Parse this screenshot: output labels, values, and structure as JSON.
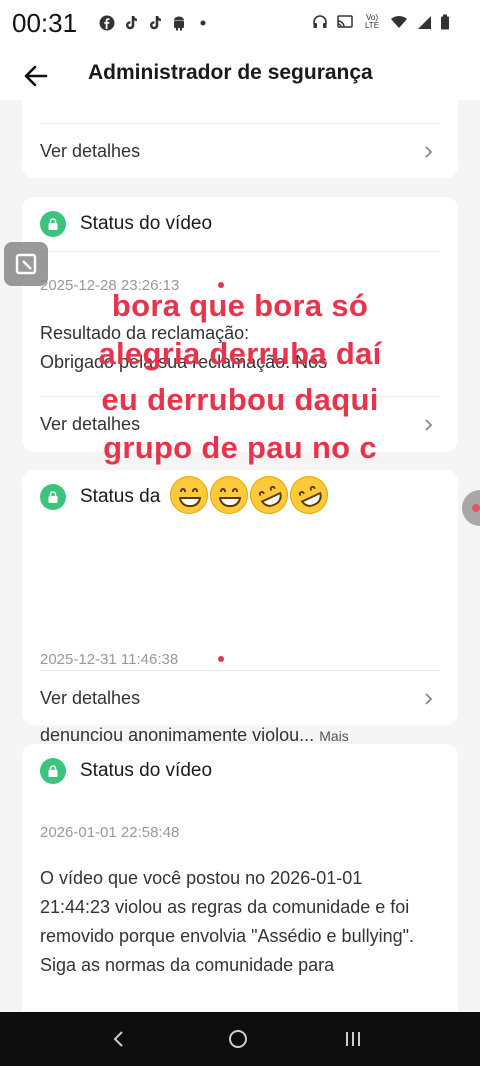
{
  "status_bar": {
    "time": "00:31",
    "notification_icons": [
      "facebook-icon",
      "tiktok-icon",
      "tiktok-icon",
      "android-icon",
      "dot-icon"
    ],
    "system_icons": [
      "headphones-icon",
      "cast-icon",
      "volte-icon",
      "wifi-icon",
      "signal-icon",
      "battery-icon"
    ],
    "volte_label": "Vo) LTE"
  },
  "app_bar": {
    "title": "Administrador de segurança"
  },
  "cards": [
    {
      "details_label": "Ver detalhes"
    },
    {
      "title": "Status do vídeo",
      "date": "2025-12-28 23:26:13",
      "body_line1": "Resultado da reclamação:",
      "body_line2": "Obrigado pela sua reclamação. Nós",
      "details_label": "Ver detalhes"
    },
    {
      "title": "Status da",
      "date": "2025-12-31 11:46:38",
      "body": "O usuário \\\"Live Kwai BR\\\" que você denunciou anonimamente violou...",
      "more_label": "Mais",
      "details_label": "Ver detalhes"
    },
    {
      "title": "Status do vídeo",
      "date": "2026-01-01 22:58:48",
      "body": "O vídeo que você postou no 2026-01-01 21:44:23 violou as regras da comunidade e foi removido porque envolvia \"Assédio e bullying\".\nSiga as normas da comunidade para"
    }
  ],
  "overlay": {
    "lines": [
      "bora que bora só",
      "alegria derruba daí",
      "eu derrubou daqui",
      "grupo de pau no c"
    ],
    "emojis": [
      "grinning-face",
      "grinning-face",
      "rofl-face",
      "rofl-face"
    ],
    "color": "#e8334a"
  },
  "colors": {
    "accent_green": "#3cc47c",
    "unread_dot": "#e03a4a",
    "background": "#f5f5f5"
  },
  "nav_bar": {
    "buttons": [
      "back-icon",
      "home-icon",
      "recents-icon"
    ]
  }
}
